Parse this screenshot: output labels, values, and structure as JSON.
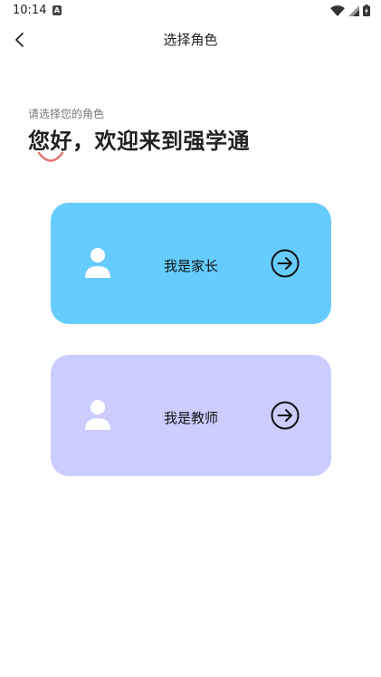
{
  "status_bar": {
    "time": "10:14",
    "notification_glyph": "A",
    "icons": [
      "wifi-icon",
      "signal-icon",
      "battery-icon"
    ]
  },
  "header": {
    "back_icon": "chevron-left-icon",
    "title": "选择角色"
  },
  "intro": {
    "subtitle": "请选择您的角色",
    "welcome": "您好，欢迎来到强学通"
  },
  "roles": [
    {
      "label": "我是家长",
      "color": "#66ccff",
      "icon": "user-icon",
      "action_icon": "arrow-right-circle-icon"
    },
    {
      "label": "我是教师",
      "color": "#ccccff",
      "icon": "user-icon",
      "action_icon": "arrow-right-circle-icon"
    }
  ],
  "colors": {
    "accent_smile": "#e57373",
    "text_primary": "#222222",
    "text_secondary": "#777777"
  }
}
